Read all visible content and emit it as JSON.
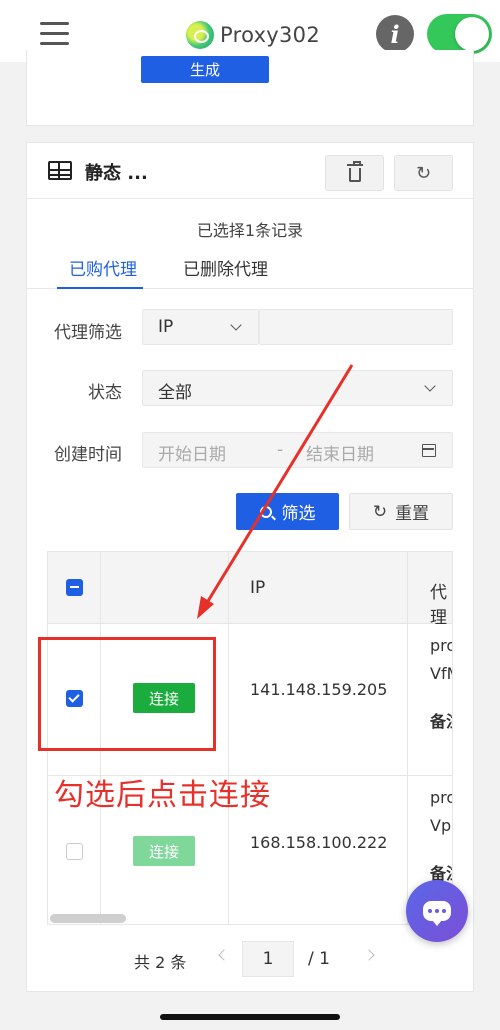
{
  "app": {
    "title": "Proxy302",
    "toggle_on": true
  },
  "prev_card": {
    "generate_label": "生成"
  },
  "card": {
    "title": "静态 ...",
    "selected_info": "已选择1条记录",
    "tabs": [
      {
        "label": "已购代理",
        "active": true
      },
      {
        "label": "已删除代理",
        "active": false
      }
    ]
  },
  "filters": {
    "proxy_filter_label": "代理筛选",
    "proxy_filter_type": "IP",
    "proxy_filter_value": "",
    "status_label": "状态",
    "status_value": "全部",
    "created_label": "创建时间",
    "start_date_placeholder": "开始日期",
    "date_separator": "-",
    "end_date_placeholder": "结束日期",
    "filter_button": "筛选",
    "reset_button": "重置"
  },
  "table": {
    "columns": [
      "",
      "",
      "IP",
      "代理"
    ],
    "rows": [
      {
        "checked": true,
        "connect_label": "连接",
        "ip": "141.148.159.205",
        "proxy_line1": "pro",
        "proxy_line2": "VfM",
        "proxy_note": "备注"
      },
      {
        "checked": false,
        "connect_label": "连接",
        "ip": "168.158.100.222",
        "proxy_line1": "pro",
        "proxy_line2": "Vpa",
        "proxy_note": "备注"
      }
    ]
  },
  "pagination": {
    "total": "共 2 条",
    "current": "1",
    "of": "/  1"
  },
  "annotation": {
    "text": "勾选后点击连接",
    "color": "#e8302a"
  },
  "colors": {
    "primary": "#1f5fe3",
    "connect": "#1aac3c",
    "toggle": "#34c759"
  }
}
